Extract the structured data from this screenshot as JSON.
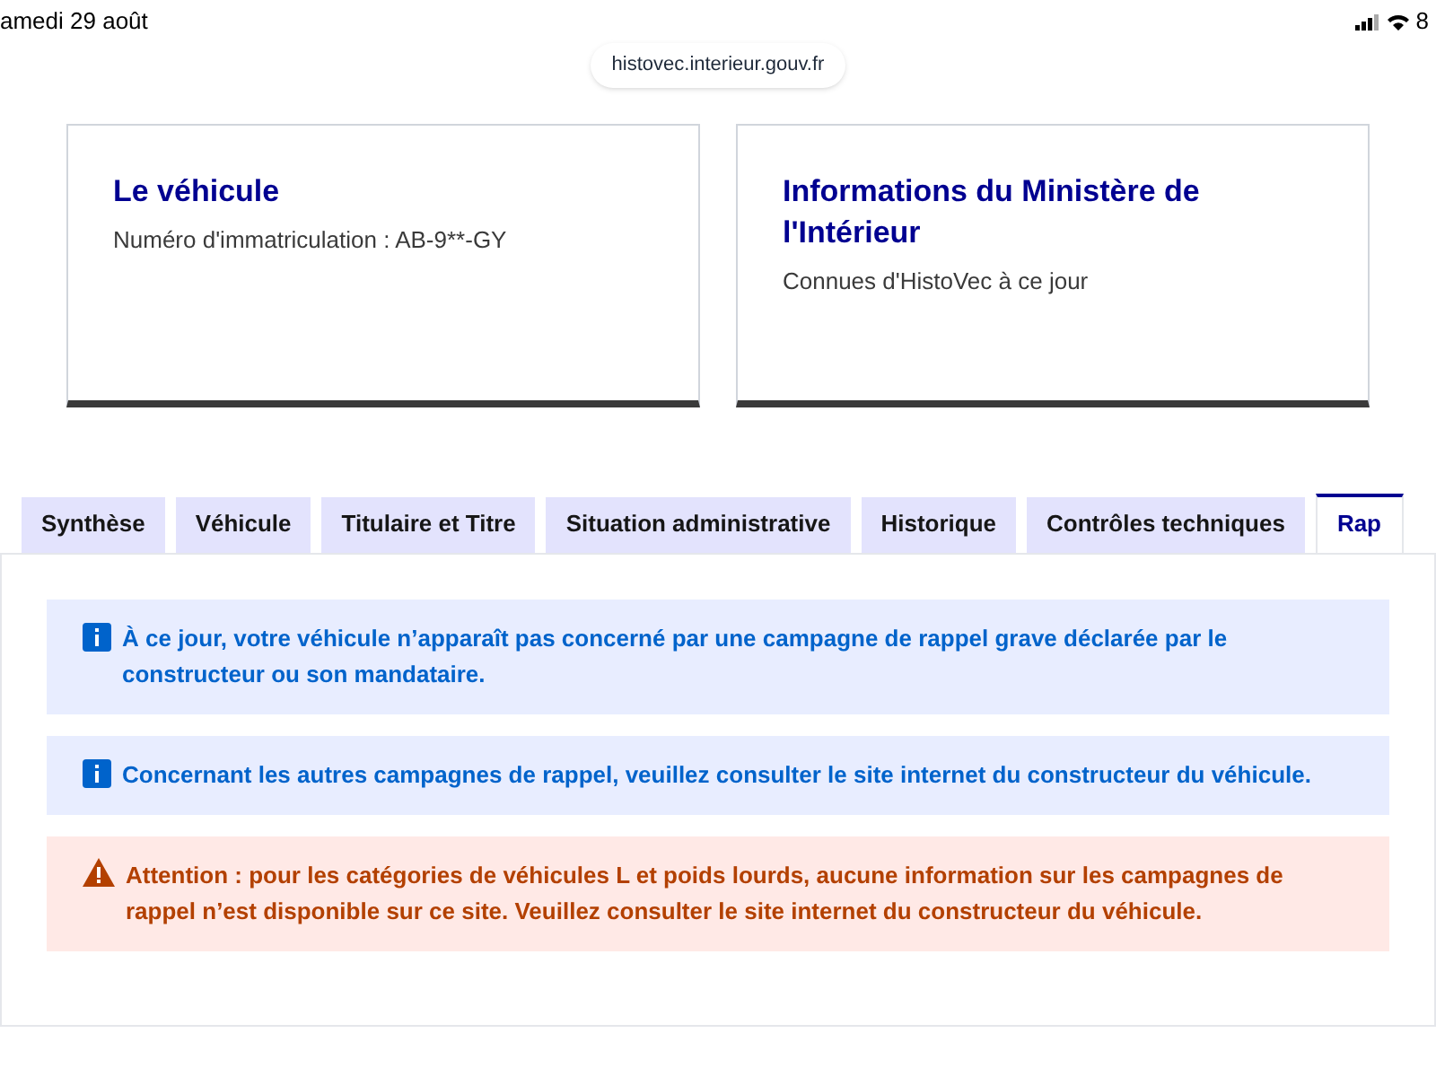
{
  "status_bar": {
    "date": "amedi 29 août",
    "battery": "8"
  },
  "address_bar": {
    "url": "histovec.interieur.gouv.fr"
  },
  "cards": [
    {
      "title": "Le véhicule",
      "subtitle": "Numéro d'immatriculation : AB-9**-GY"
    },
    {
      "title": "Informations du Ministère de l'Intérieur",
      "subtitle": "Connues d'HistoVec à ce jour"
    }
  ],
  "tabs": [
    {
      "label": "Synthèse",
      "selected": false
    },
    {
      "label": "Véhicule",
      "selected": false
    },
    {
      "label": "Titulaire et Titre",
      "selected": false
    },
    {
      "label": "Situation administrative",
      "selected": false
    },
    {
      "label": "Historique",
      "selected": false
    },
    {
      "label": "Contrôles techniques",
      "selected": false
    },
    {
      "label": "Rap",
      "selected": true
    }
  ],
  "alerts": [
    {
      "kind": "info",
      "text": "À ce jour, votre véhicule n’apparaît pas concerné par une campagne de rappel grave déclarée par le constructeur ou son mandataire."
    },
    {
      "kind": "info",
      "text": "Concernant les autres campagnes de rappel, veuillez consulter le site internet du constructeur du véhicule."
    },
    {
      "kind": "warning",
      "text": "Attention : pour les catégories de véhicules L et poids lourds, aucune information sur les campagnes de rappel n’est disponible sur ce site. Veuillez consulter le site internet du constructeur du véhicule."
    }
  ]
}
